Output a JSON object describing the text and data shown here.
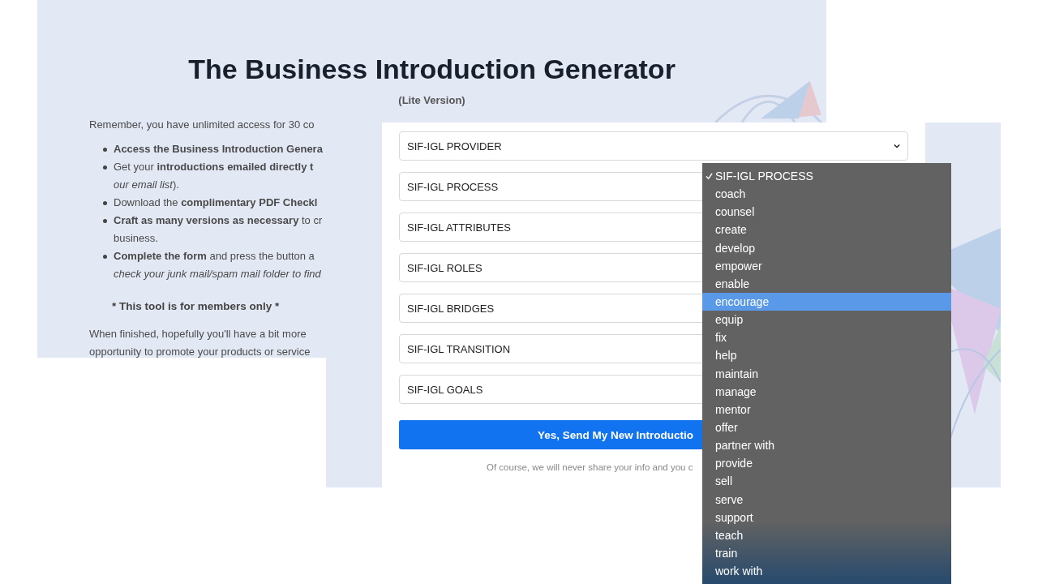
{
  "back_page": {
    "title": "The Business Introduction Generator",
    "subtitle": "(Lite Version)",
    "intro": "Remember, you have unlimited access for 30 co",
    "bullets": [
      {
        "lines": [
          "**Access the Business Introduction Genera**"
        ]
      },
      {
        "lines": [
          "Get your **introductions emailed directly t**",
          "*our email list*)."
        ]
      },
      {
        "lines": [
          "Download the **complimentary PDF Checkl**"
        ]
      },
      {
        "lines": [
          "**Craft as many versions as necessary** to cr",
          "business."
        ]
      },
      {
        "lines": [
          "**Complete the form** and press the button a",
          "*check your junk mail/spam mail folder to find*"
        ]
      }
    ],
    "notice": "* This tool is for members only *",
    "closing": [
      "When finished, hopefully you'll have a bit more",
      "opportunity to promote your products or service"
    ]
  },
  "form": {
    "selects": [
      {
        "label": "SIF-IGL PROVIDER"
      },
      {
        "label": "SIF-IGL PROCESS"
      },
      {
        "label": "SIF-IGL ATTRIBUTES"
      },
      {
        "label": "SIF-IGL ROLES"
      },
      {
        "label": "SIF-IGL BRIDGES"
      },
      {
        "label": "SIF-IGL TRANSITION"
      },
      {
        "label": "SIF-IGL GOALS"
      }
    ],
    "submit": "Yes, Send My New Introductio",
    "privacy": "Of course, we will never share your info and you c"
  },
  "dropdown": {
    "options": [
      {
        "label": "SIF-IGL PROCESS",
        "selected": true,
        "highlighted": false
      },
      {
        "label": "coach",
        "selected": false,
        "highlighted": false
      },
      {
        "label": "counsel",
        "selected": false,
        "highlighted": false
      },
      {
        "label": "create",
        "selected": false,
        "highlighted": false
      },
      {
        "label": "develop",
        "selected": false,
        "highlighted": false
      },
      {
        "label": "empower",
        "selected": false,
        "highlighted": false
      },
      {
        "label": "enable",
        "selected": false,
        "highlighted": false
      },
      {
        "label": "encourage",
        "selected": false,
        "highlighted": true
      },
      {
        "label": "equip",
        "selected": false,
        "highlighted": false
      },
      {
        "label": "fix",
        "selected": false,
        "highlighted": false
      },
      {
        "label": "help",
        "selected": false,
        "highlighted": false
      },
      {
        "label": "maintain",
        "selected": false,
        "highlighted": false
      },
      {
        "label": "manage",
        "selected": false,
        "highlighted": false
      },
      {
        "label": "mentor",
        "selected": false,
        "highlighted": false
      },
      {
        "label": "offer",
        "selected": false,
        "highlighted": false
      },
      {
        "label": "partner with",
        "selected": false,
        "highlighted": false
      },
      {
        "label": "provide",
        "selected": false,
        "highlighted": false
      },
      {
        "label": "sell",
        "selected": false,
        "highlighted": false
      },
      {
        "label": "serve",
        "selected": false,
        "highlighted": false
      },
      {
        "label": "support",
        "selected": false,
        "highlighted": false
      },
      {
        "label": "teach",
        "selected": false,
        "highlighted": false
      },
      {
        "label": "train",
        "selected": false,
        "highlighted": false
      },
      {
        "label": "work with",
        "selected": false,
        "highlighted": false
      }
    ]
  }
}
